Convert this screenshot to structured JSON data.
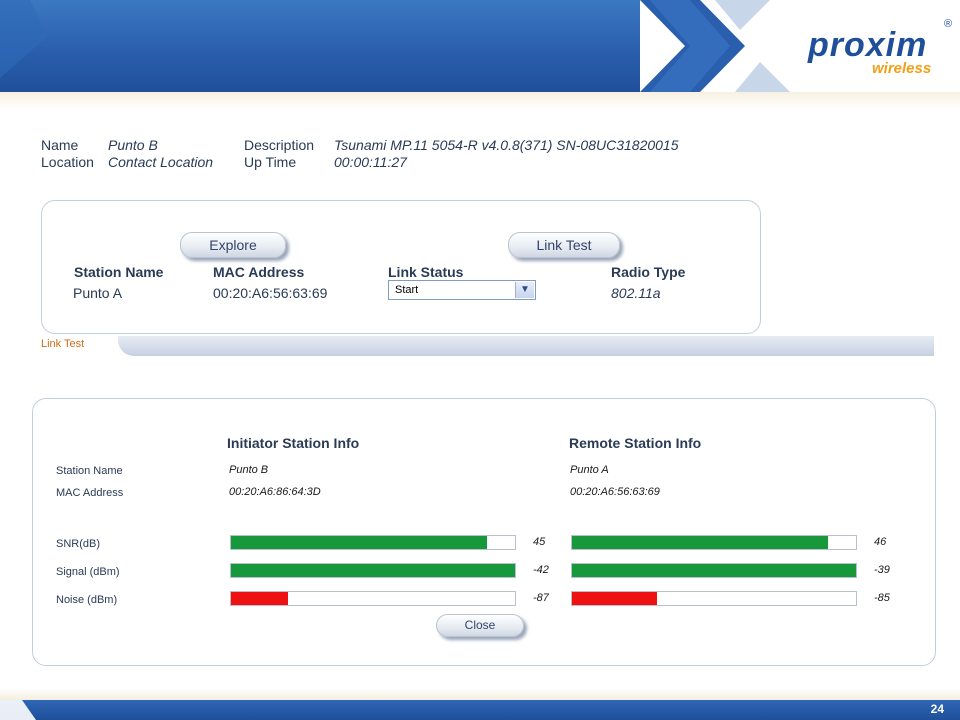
{
  "brand": {
    "logo_main": "proxim",
    "logo_sub": "wireless",
    "reg": "®",
    "primary_color": "#1f4f9a",
    "accent_color": "#f0a019"
  },
  "info": {
    "name_label": "Name",
    "name_value": "Punto B",
    "location_label": "Location",
    "location_value": "Contact Location",
    "description_label": "Description",
    "description_value": "Tsunami MP.11 5054-R v4.0.8(371) SN-08UC31820015",
    "uptime_label": "Up Time",
    "uptime_value": "00:00:11:27"
  },
  "link_panel": {
    "explore_label": "Explore",
    "link_test_label": "Link Test",
    "headers": {
      "station_name": "Station Name",
      "mac_address": "MAC Address",
      "link_status": "Link Status",
      "radio_type": "Radio Type"
    },
    "row": {
      "station_name": "Punto A",
      "mac_address": "00:20:A6:56:63:69",
      "link_status": "Start",
      "radio_type": "802.11a"
    }
  },
  "tab": {
    "label": "Link Test"
  },
  "link_test": {
    "initiator_title": "Initiator Station Info",
    "remote_title": "Remote Station Info",
    "labels": {
      "station_name": "Station Name",
      "mac_address": "MAC Address",
      "snr": "SNR(dB)",
      "signal": "Signal (dBm)",
      "noise": "Noise (dBm)"
    },
    "initiator": {
      "station_name": "Punto B",
      "mac_address": "00:20:A6:86:64:3D",
      "snr": "45",
      "signal": "-42",
      "noise": "-87",
      "snr_fill": 0.9,
      "signal_fill": 1.0,
      "noise_fill": 0.2
    },
    "remote": {
      "station_name": "Punto A",
      "mac_address": "00:20:A6:56:63:69",
      "snr": "46",
      "signal": "-39",
      "noise": "-85",
      "snr_fill": 0.9,
      "signal_fill": 1.0,
      "noise_fill": 0.3
    },
    "good_color": "#17983a",
    "bad_color": "#ee1111",
    "close_label": "Close"
  },
  "footer": {
    "page_number": "24"
  }
}
